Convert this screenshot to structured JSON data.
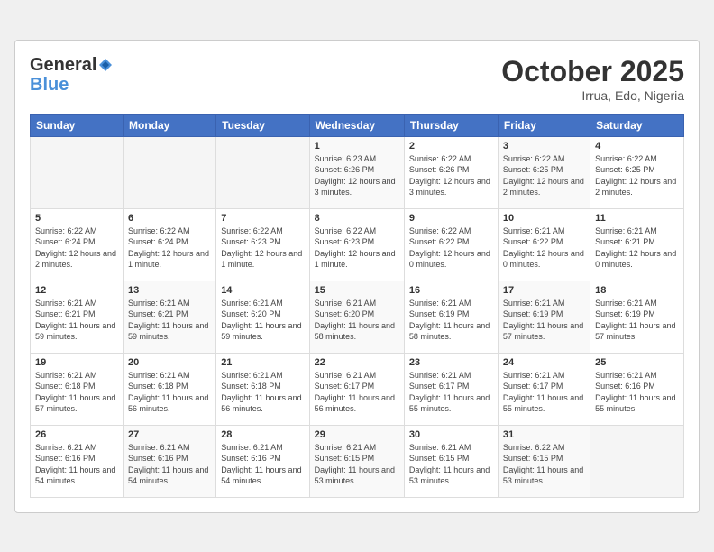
{
  "header": {
    "logo_text_general": "General",
    "logo_text_blue": "Blue",
    "month": "October 2025",
    "location": "Irrua, Edo, Nigeria"
  },
  "weekdays": [
    "Sunday",
    "Monday",
    "Tuesday",
    "Wednesday",
    "Thursday",
    "Friday",
    "Saturday"
  ],
  "weeks": [
    [
      {
        "day": "",
        "sunrise": "",
        "sunset": "",
        "daylight": "",
        "empty": true
      },
      {
        "day": "",
        "sunrise": "",
        "sunset": "",
        "daylight": "",
        "empty": true
      },
      {
        "day": "",
        "sunrise": "",
        "sunset": "",
        "daylight": "",
        "empty": true
      },
      {
        "day": "1",
        "sunrise": "Sunrise: 6:23 AM",
        "sunset": "Sunset: 6:26 PM",
        "daylight": "Daylight: 12 hours and 3 minutes."
      },
      {
        "day": "2",
        "sunrise": "Sunrise: 6:22 AM",
        "sunset": "Sunset: 6:26 PM",
        "daylight": "Daylight: 12 hours and 3 minutes."
      },
      {
        "day": "3",
        "sunrise": "Sunrise: 6:22 AM",
        "sunset": "Sunset: 6:25 PM",
        "daylight": "Daylight: 12 hours and 2 minutes."
      },
      {
        "day": "4",
        "sunrise": "Sunrise: 6:22 AM",
        "sunset": "Sunset: 6:25 PM",
        "daylight": "Daylight: 12 hours and 2 minutes."
      }
    ],
    [
      {
        "day": "5",
        "sunrise": "Sunrise: 6:22 AM",
        "sunset": "Sunset: 6:24 PM",
        "daylight": "Daylight: 12 hours and 2 minutes."
      },
      {
        "day": "6",
        "sunrise": "Sunrise: 6:22 AM",
        "sunset": "Sunset: 6:24 PM",
        "daylight": "Daylight: 12 hours and 1 minute."
      },
      {
        "day": "7",
        "sunrise": "Sunrise: 6:22 AM",
        "sunset": "Sunset: 6:23 PM",
        "daylight": "Daylight: 12 hours and 1 minute."
      },
      {
        "day": "8",
        "sunrise": "Sunrise: 6:22 AM",
        "sunset": "Sunset: 6:23 PM",
        "daylight": "Daylight: 12 hours and 1 minute."
      },
      {
        "day": "9",
        "sunrise": "Sunrise: 6:22 AM",
        "sunset": "Sunset: 6:22 PM",
        "daylight": "Daylight: 12 hours and 0 minutes."
      },
      {
        "day": "10",
        "sunrise": "Sunrise: 6:21 AM",
        "sunset": "Sunset: 6:22 PM",
        "daylight": "Daylight: 12 hours and 0 minutes."
      },
      {
        "day": "11",
        "sunrise": "Sunrise: 6:21 AM",
        "sunset": "Sunset: 6:21 PM",
        "daylight": "Daylight: 12 hours and 0 minutes."
      }
    ],
    [
      {
        "day": "12",
        "sunrise": "Sunrise: 6:21 AM",
        "sunset": "Sunset: 6:21 PM",
        "daylight": "Daylight: 11 hours and 59 minutes."
      },
      {
        "day": "13",
        "sunrise": "Sunrise: 6:21 AM",
        "sunset": "Sunset: 6:21 PM",
        "daylight": "Daylight: 11 hours and 59 minutes."
      },
      {
        "day": "14",
        "sunrise": "Sunrise: 6:21 AM",
        "sunset": "Sunset: 6:20 PM",
        "daylight": "Daylight: 11 hours and 59 minutes."
      },
      {
        "day": "15",
        "sunrise": "Sunrise: 6:21 AM",
        "sunset": "Sunset: 6:20 PM",
        "daylight": "Daylight: 11 hours and 58 minutes."
      },
      {
        "day": "16",
        "sunrise": "Sunrise: 6:21 AM",
        "sunset": "Sunset: 6:19 PM",
        "daylight": "Daylight: 11 hours and 58 minutes."
      },
      {
        "day": "17",
        "sunrise": "Sunrise: 6:21 AM",
        "sunset": "Sunset: 6:19 PM",
        "daylight": "Daylight: 11 hours and 57 minutes."
      },
      {
        "day": "18",
        "sunrise": "Sunrise: 6:21 AM",
        "sunset": "Sunset: 6:19 PM",
        "daylight": "Daylight: 11 hours and 57 minutes."
      }
    ],
    [
      {
        "day": "19",
        "sunrise": "Sunrise: 6:21 AM",
        "sunset": "Sunset: 6:18 PM",
        "daylight": "Daylight: 11 hours and 57 minutes."
      },
      {
        "day": "20",
        "sunrise": "Sunrise: 6:21 AM",
        "sunset": "Sunset: 6:18 PM",
        "daylight": "Daylight: 11 hours and 56 minutes."
      },
      {
        "day": "21",
        "sunrise": "Sunrise: 6:21 AM",
        "sunset": "Sunset: 6:18 PM",
        "daylight": "Daylight: 11 hours and 56 minutes."
      },
      {
        "day": "22",
        "sunrise": "Sunrise: 6:21 AM",
        "sunset": "Sunset: 6:17 PM",
        "daylight": "Daylight: 11 hours and 56 minutes."
      },
      {
        "day": "23",
        "sunrise": "Sunrise: 6:21 AM",
        "sunset": "Sunset: 6:17 PM",
        "daylight": "Daylight: 11 hours and 55 minutes."
      },
      {
        "day": "24",
        "sunrise": "Sunrise: 6:21 AM",
        "sunset": "Sunset: 6:17 PM",
        "daylight": "Daylight: 11 hours and 55 minutes."
      },
      {
        "day": "25",
        "sunrise": "Sunrise: 6:21 AM",
        "sunset": "Sunset: 6:16 PM",
        "daylight": "Daylight: 11 hours and 55 minutes."
      }
    ],
    [
      {
        "day": "26",
        "sunrise": "Sunrise: 6:21 AM",
        "sunset": "Sunset: 6:16 PM",
        "daylight": "Daylight: 11 hours and 54 minutes."
      },
      {
        "day": "27",
        "sunrise": "Sunrise: 6:21 AM",
        "sunset": "Sunset: 6:16 PM",
        "daylight": "Daylight: 11 hours and 54 minutes."
      },
      {
        "day": "28",
        "sunrise": "Sunrise: 6:21 AM",
        "sunset": "Sunset: 6:16 PM",
        "daylight": "Daylight: 11 hours and 54 minutes."
      },
      {
        "day": "29",
        "sunrise": "Sunrise: 6:21 AM",
        "sunset": "Sunset: 6:15 PM",
        "daylight": "Daylight: 11 hours and 53 minutes."
      },
      {
        "day": "30",
        "sunrise": "Sunrise: 6:21 AM",
        "sunset": "Sunset: 6:15 PM",
        "daylight": "Daylight: 11 hours and 53 minutes."
      },
      {
        "day": "31",
        "sunrise": "Sunrise: 6:22 AM",
        "sunset": "Sunset: 6:15 PM",
        "daylight": "Daylight: 11 hours and 53 minutes."
      },
      {
        "day": "",
        "sunrise": "",
        "sunset": "",
        "daylight": "",
        "empty": true
      }
    ]
  ]
}
